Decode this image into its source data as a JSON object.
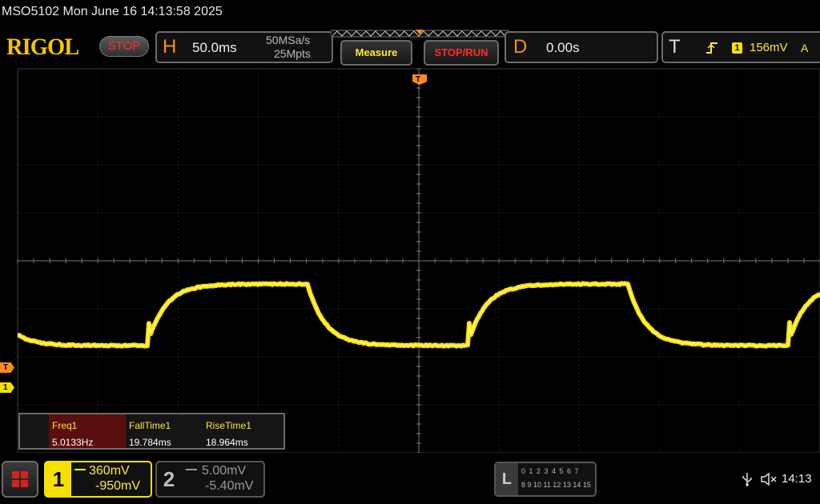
{
  "window": {
    "title": "MSO5102  Mon June 16 14:13:58 2025"
  },
  "brand": {
    "logo": "RIGOL",
    "run_state": "STOP"
  },
  "horizontal": {
    "letter": "H",
    "timebase": "50.0ms",
    "sample_rate": "50MSa/s",
    "memory_depth": "25Mpts"
  },
  "buttons": {
    "measure": "Measure",
    "stop_run": "STOP/RUN"
  },
  "delay": {
    "letter": "D",
    "value": "0.00s"
  },
  "trigger": {
    "letter": "T",
    "source": "1",
    "level": "156mV",
    "mode": "A",
    "icon": "rising-edge-icon"
  },
  "markers": {
    "trigger_top": "T",
    "trigger_level": "T",
    "ch1_ground": "1"
  },
  "measurements": [
    {
      "label": "Freq1",
      "value": "5.0133Hz"
    },
    {
      "label": "FallTime1",
      "value": "19.784ms"
    },
    {
      "label": "RiseTime1",
      "value": "18.964ms"
    }
  ],
  "channels": [
    {
      "num": "1",
      "scale": "360mV",
      "offset": "-950mV",
      "color": "#f5e000",
      "active": true
    },
    {
      "num": "2",
      "scale": "5.00mV",
      "offset": "-5.40mV",
      "color": "#888888",
      "active": false
    }
  ],
  "logic": {
    "letter": "L",
    "row1": "0 1 2 3   4 5 6 7",
    "row2": "8 9 10 11 12 13 14 15"
  },
  "status": {
    "clock": "14:13",
    "usb_icon": "usb-icon",
    "speaker_icon": "speaker-muted-icon"
  },
  "colors": {
    "ch1": "#f5e000",
    "accent": "#ff8a1f",
    "stop": "#ff2a2a"
  }
}
